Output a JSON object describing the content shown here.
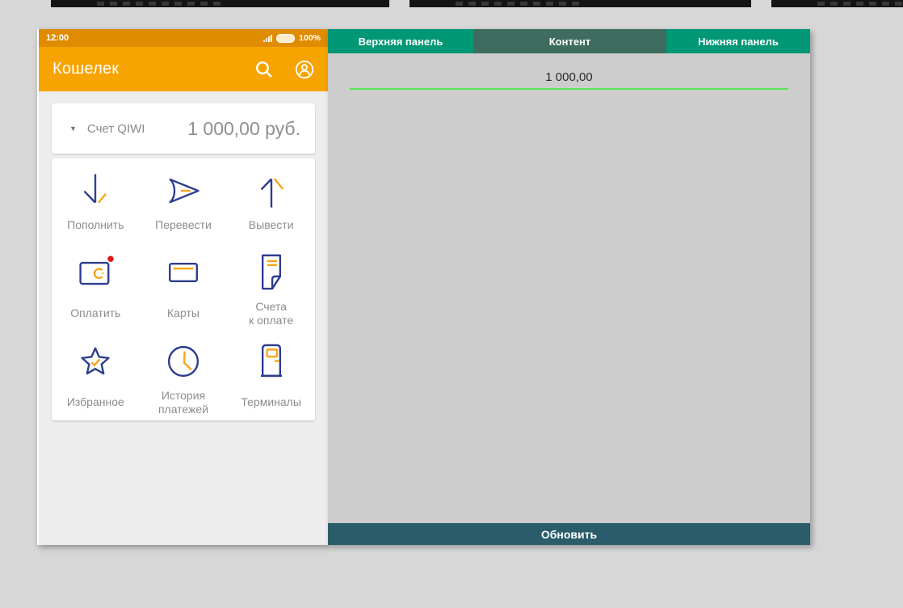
{
  "phone": {
    "status_bar": {
      "time": "12:00",
      "battery_percent": "100%"
    },
    "header": {
      "title": "Кошелек"
    },
    "account": {
      "label": "Счет QIWI",
      "balance": "1 000,00 руб."
    },
    "menu": {
      "items": [
        {
          "label": "Пополнить",
          "icon": "arrow-down-icon"
        },
        {
          "label": "Перевести",
          "icon": "send-icon"
        },
        {
          "label": "Вывести",
          "icon": "arrow-up-icon"
        },
        {
          "label": "Оплатить",
          "icon": "wallet-icon",
          "has_badge": true
        },
        {
          "label": "Карты",
          "icon": "card-icon"
        },
        {
          "label": "Счета\nк оплате",
          "icon": "bill-icon"
        },
        {
          "label": "Избранное",
          "icon": "star-icon"
        },
        {
          "label": "История\nплатежей",
          "icon": "clock-icon"
        },
        {
          "label": "Терминалы",
          "icon": "terminal-icon"
        }
      ]
    }
  },
  "panel": {
    "tabs": [
      {
        "label": "Верхняя панель"
      },
      {
        "label": "Контент"
      },
      {
        "label": "Нижняя панель"
      }
    ],
    "content": {
      "value": "1 000,00"
    },
    "refresh_label": "Обновить"
  },
  "colors": {
    "header_orange": "#f7a301",
    "status_bar_orange": "#df8c00",
    "icon_navy": "#2e3d8f",
    "icon_orange": "#f9a51b",
    "badge_red": "#e01414",
    "tab_green": "#009874",
    "tab_dark_green": "#3e6c5e",
    "refresh_teal": "#2b5c69",
    "underline_green": "#55e455"
  }
}
